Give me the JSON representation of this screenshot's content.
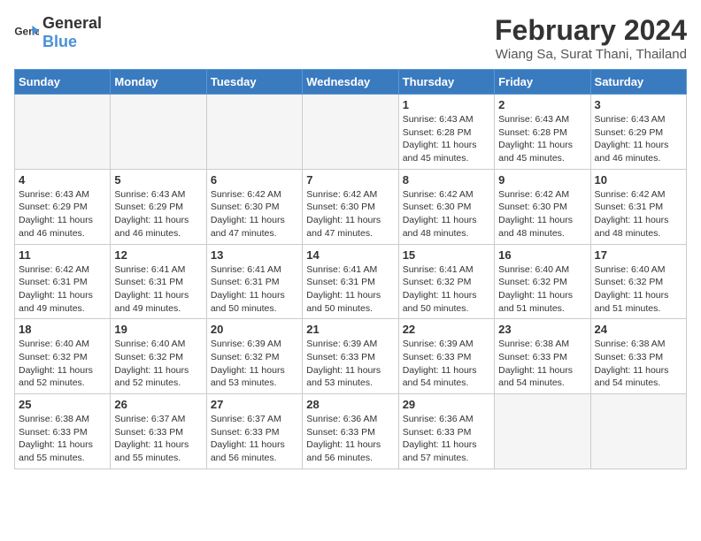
{
  "header": {
    "logo_general": "General",
    "logo_blue": "Blue",
    "month_title": "February 2024",
    "location": "Wiang Sa, Surat Thani, Thailand"
  },
  "weekdays": [
    "Sunday",
    "Monday",
    "Tuesday",
    "Wednesday",
    "Thursday",
    "Friday",
    "Saturday"
  ],
  "weeks": [
    [
      {
        "day": "",
        "info": ""
      },
      {
        "day": "",
        "info": ""
      },
      {
        "day": "",
        "info": ""
      },
      {
        "day": "",
        "info": ""
      },
      {
        "day": "1",
        "info": "Sunrise: 6:43 AM\nSunset: 6:28 PM\nDaylight: 11 hours and 45 minutes."
      },
      {
        "day": "2",
        "info": "Sunrise: 6:43 AM\nSunset: 6:28 PM\nDaylight: 11 hours and 45 minutes."
      },
      {
        "day": "3",
        "info": "Sunrise: 6:43 AM\nSunset: 6:29 PM\nDaylight: 11 hours and 46 minutes."
      }
    ],
    [
      {
        "day": "4",
        "info": "Sunrise: 6:43 AM\nSunset: 6:29 PM\nDaylight: 11 hours and 46 minutes."
      },
      {
        "day": "5",
        "info": "Sunrise: 6:43 AM\nSunset: 6:29 PM\nDaylight: 11 hours and 46 minutes."
      },
      {
        "day": "6",
        "info": "Sunrise: 6:42 AM\nSunset: 6:30 PM\nDaylight: 11 hours and 47 minutes."
      },
      {
        "day": "7",
        "info": "Sunrise: 6:42 AM\nSunset: 6:30 PM\nDaylight: 11 hours and 47 minutes."
      },
      {
        "day": "8",
        "info": "Sunrise: 6:42 AM\nSunset: 6:30 PM\nDaylight: 11 hours and 48 minutes."
      },
      {
        "day": "9",
        "info": "Sunrise: 6:42 AM\nSunset: 6:30 PM\nDaylight: 11 hours and 48 minutes."
      },
      {
        "day": "10",
        "info": "Sunrise: 6:42 AM\nSunset: 6:31 PM\nDaylight: 11 hours and 48 minutes."
      }
    ],
    [
      {
        "day": "11",
        "info": "Sunrise: 6:42 AM\nSunset: 6:31 PM\nDaylight: 11 hours and 49 minutes."
      },
      {
        "day": "12",
        "info": "Sunrise: 6:41 AM\nSunset: 6:31 PM\nDaylight: 11 hours and 49 minutes."
      },
      {
        "day": "13",
        "info": "Sunrise: 6:41 AM\nSunset: 6:31 PM\nDaylight: 11 hours and 50 minutes."
      },
      {
        "day": "14",
        "info": "Sunrise: 6:41 AM\nSunset: 6:31 PM\nDaylight: 11 hours and 50 minutes."
      },
      {
        "day": "15",
        "info": "Sunrise: 6:41 AM\nSunset: 6:32 PM\nDaylight: 11 hours and 50 minutes."
      },
      {
        "day": "16",
        "info": "Sunrise: 6:40 AM\nSunset: 6:32 PM\nDaylight: 11 hours and 51 minutes."
      },
      {
        "day": "17",
        "info": "Sunrise: 6:40 AM\nSunset: 6:32 PM\nDaylight: 11 hours and 51 minutes."
      }
    ],
    [
      {
        "day": "18",
        "info": "Sunrise: 6:40 AM\nSunset: 6:32 PM\nDaylight: 11 hours and 52 minutes."
      },
      {
        "day": "19",
        "info": "Sunrise: 6:40 AM\nSunset: 6:32 PM\nDaylight: 11 hours and 52 minutes."
      },
      {
        "day": "20",
        "info": "Sunrise: 6:39 AM\nSunset: 6:32 PM\nDaylight: 11 hours and 53 minutes."
      },
      {
        "day": "21",
        "info": "Sunrise: 6:39 AM\nSunset: 6:33 PM\nDaylight: 11 hours and 53 minutes."
      },
      {
        "day": "22",
        "info": "Sunrise: 6:39 AM\nSunset: 6:33 PM\nDaylight: 11 hours and 54 minutes."
      },
      {
        "day": "23",
        "info": "Sunrise: 6:38 AM\nSunset: 6:33 PM\nDaylight: 11 hours and 54 minutes."
      },
      {
        "day": "24",
        "info": "Sunrise: 6:38 AM\nSunset: 6:33 PM\nDaylight: 11 hours and 54 minutes."
      }
    ],
    [
      {
        "day": "25",
        "info": "Sunrise: 6:38 AM\nSunset: 6:33 PM\nDaylight: 11 hours and 55 minutes."
      },
      {
        "day": "26",
        "info": "Sunrise: 6:37 AM\nSunset: 6:33 PM\nDaylight: 11 hours and 55 minutes."
      },
      {
        "day": "27",
        "info": "Sunrise: 6:37 AM\nSunset: 6:33 PM\nDaylight: 11 hours and 56 minutes."
      },
      {
        "day": "28",
        "info": "Sunrise: 6:36 AM\nSunset: 6:33 PM\nDaylight: 11 hours and 56 minutes."
      },
      {
        "day": "29",
        "info": "Sunrise: 6:36 AM\nSunset: 6:33 PM\nDaylight: 11 hours and 57 minutes."
      },
      {
        "day": "",
        "info": ""
      },
      {
        "day": "",
        "info": ""
      }
    ]
  ]
}
